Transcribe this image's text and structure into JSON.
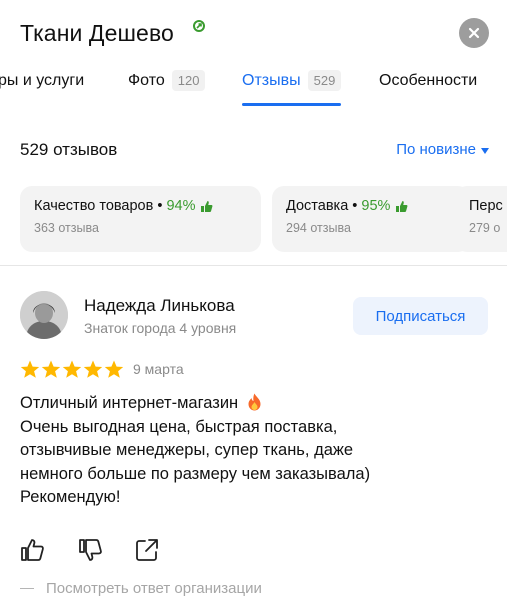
{
  "header": {
    "title": "Ткани Дешево",
    "close_icon": "close-icon",
    "verified_icon": "verified-icon"
  },
  "tabs": [
    {
      "label": "ры и услуги",
      "count": ""
    },
    {
      "label": "Фото",
      "count": "120"
    },
    {
      "label": "Отзывы",
      "count": "529",
      "active": true
    },
    {
      "label": "Особенности",
      "count": ""
    }
  ],
  "reviews": {
    "count_label": "529 отзывов",
    "sort_label": "По новизне"
  },
  "aspects": [
    {
      "name": "Качество товаров",
      "percent": "94%",
      "sub": "363 отзыва"
    },
    {
      "name": "Доставка",
      "percent": "95%",
      "sub": "294 отзыва"
    },
    {
      "name": "Перс",
      "percent": "",
      "sub": "279 о"
    }
  ],
  "review": {
    "author": "Надежда Линькова",
    "level": "Знаток города 4 уровня",
    "subscribe_label": "Подписаться",
    "rating": 5,
    "date": "9 марта",
    "lines": [
      "Отличный интернет-магазин",
      "Очень выгодная цена, быстрая поставка,",
      "отзывчивые менеджеры, супер ткань, даже",
      "немного больше по размеру чем заказывала)",
      "Рекомендую!"
    ],
    "reply_link": "Посмотреть ответ организации"
  },
  "colors": {
    "accent": "#1a6ef0",
    "green": "#3a9b2f",
    "star": "#ffb800",
    "muted": "#8a8a8a"
  }
}
